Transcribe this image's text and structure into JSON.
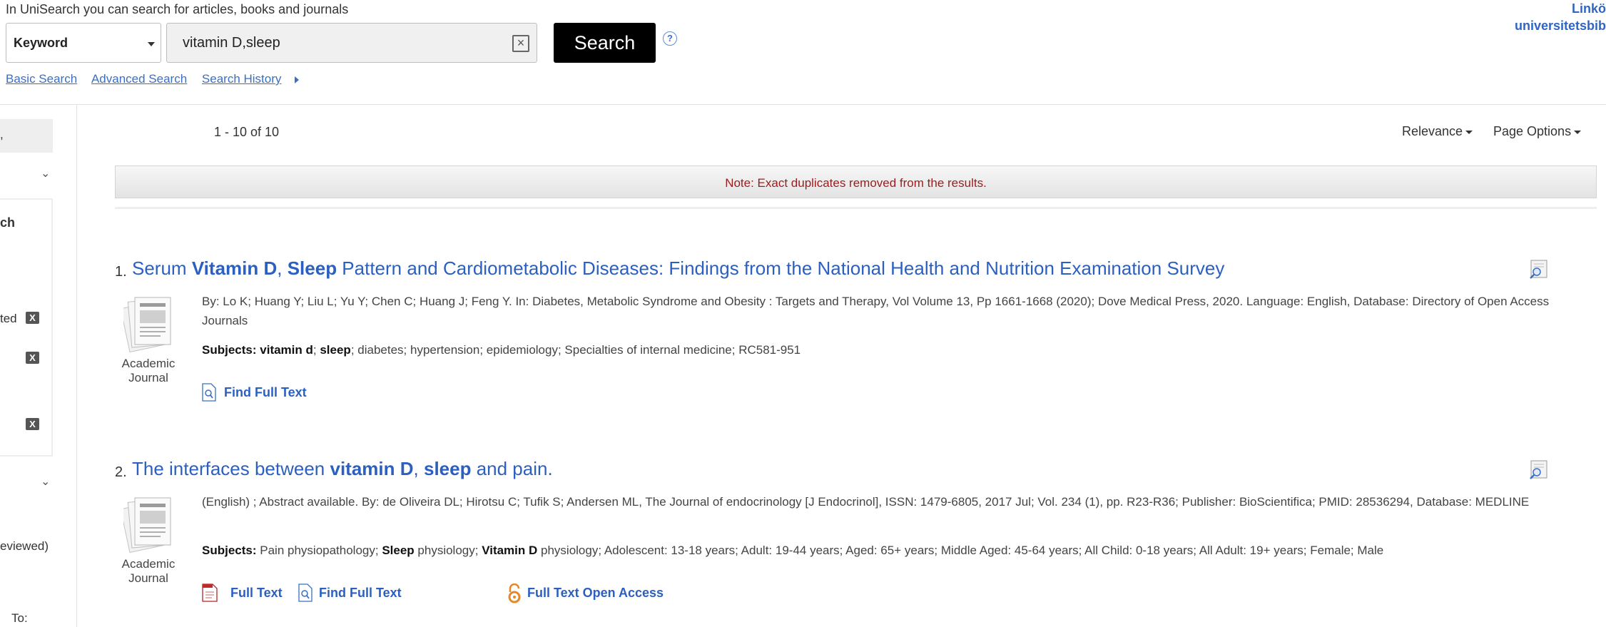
{
  "header": {
    "intro": "In UniSearch you can search for articles, books and journals",
    "field_select": "Keyword",
    "query": "vitamin D,sleep",
    "search_button": "Search",
    "help": "?",
    "links": [
      "Basic Search",
      "Advanced Search",
      "Search History"
    ],
    "library_line1": "Linkö",
    "library_line2": "universitetsbib"
  },
  "sidebar": {
    "frag1": "ch",
    "frag2": "ted",
    "frag3": "eviewed)",
    "frag4": "To:",
    "remove_label": "X"
  },
  "results_header": {
    "count": "1 - 10 of 10",
    "sort": "Relevance",
    "page_options": "Page Options",
    "note": "Note: Exact duplicates removed from the results."
  },
  "results": [
    {
      "num": "1.",
      "title_parts": [
        "Serum ",
        "Vitamin D",
        ", ",
        "Sleep",
        " Pattern and Cardiometabolic Diseases: Findings from the National Health and Nutrition Examination Survey"
      ],
      "type_line1": "Academic",
      "type_line2": "Journal",
      "meta": "By: Lo K; Huang Y; Liu L; Yu Y; Chen C; Huang J; Feng Y. In: Diabetes, Metabolic Syndrome and Obesity : Targets and Therapy, Vol Volume 13, Pp 1661-1668 (2020); Dove Medical Press, 2020. Language: English, Database: Directory of Open Access Journals",
      "subjects_label": "Subjects:",
      "subjects_parts": [
        " ",
        "vitamin d",
        "; ",
        "sleep",
        "; diabetes; hypertension; epidemiology; Specialties of internal medicine; RC581-951"
      ],
      "links": [
        "Find Full Text"
      ]
    },
    {
      "num": "2.",
      "title_parts": [
        "The interfaces between ",
        "vitamin D",
        ", ",
        "sleep",
        " and pain."
      ],
      "type_line1": "Academic",
      "type_line2": "Journal",
      "meta": "(English) ; Abstract available. By: de Oliveira DL; Hirotsu C; Tufik S; Andersen ML, The Journal of endocrinology [J Endocrinol], ISSN: 1479-6805, 2017 Jul; Vol. 234 (1), pp. R23-R36; Publisher: BioScientifica; PMID: 28536294, Database: MEDLINE",
      "subjects_label": "Subjects:",
      "subjects_parts": [
        " Pain physiopathology; ",
        "Sleep",
        " physiology; ",
        "Vitamin D",
        " physiology; Adolescent: 13-18 years; Adult: 19-44 years; Aged: 65+ years; Middle Aged: 45-64 years; All Child: 0-18 years; All Adult: 19+ years; Female; Male"
      ],
      "links": [
        "Full Text",
        "Find Full Text",
        "Full Text Open Access"
      ]
    }
  ]
}
